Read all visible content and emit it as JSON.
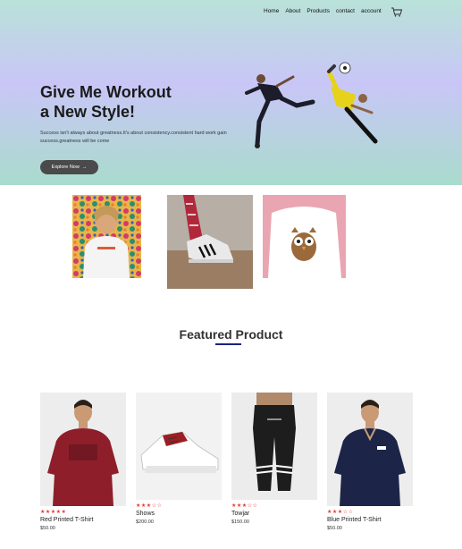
{
  "nav": {
    "items": [
      "Home",
      "About",
      "Products",
      "contact",
      "account"
    ]
  },
  "hero": {
    "title_line1": "Give Me Workout",
    "title_line2": "a New Style!",
    "subtitle": "Success isn't always about greatness.It's about consistency.consistent hard work gain success.greatness will be come",
    "cta_label": "Explore Now",
    "cta_arrow": "→"
  },
  "featured": {
    "title": "Featured Product",
    "products": [
      {
        "name": "Red Printed T-Shirt",
        "price": "$50.00",
        "rating": 5,
        "stars": "★★★★★"
      },
      {
        "name": "Shows",
        "price": "$200.00",
        "rating": 3.5,
        "stars": "★★★☆☆"
      },
      {
        "name": "Towjar",
        "price": "$150.00",
        "rating": 3.5,
        "stars": "★★★☆☆"
      },
      {
        "name": "Blue Printed T-Shirt",
        "price": "$50.00",
        "rating": 3,
        "stars": "★★★☆☆"
      }
    ]
  },
  "colors": {
    "accent": "#1a237e",
    "star": "#e53935",
    "button": "#4a4a4a"
  }
}
